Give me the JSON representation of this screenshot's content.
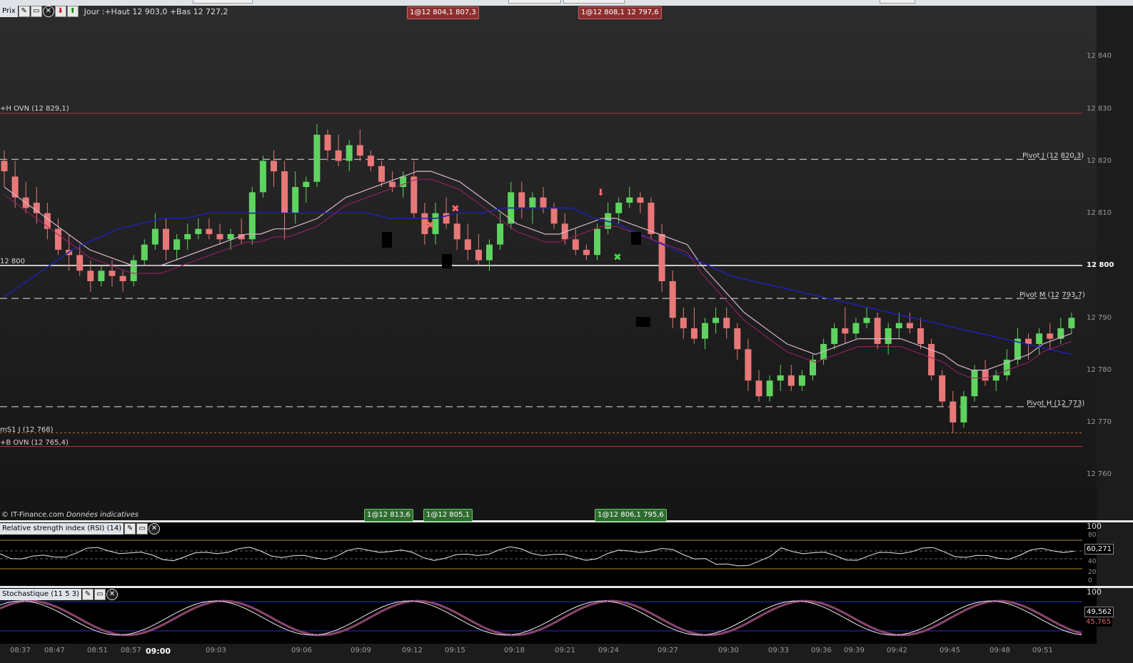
{
  "price_panel": {
    "toolbar_label": "Prix",
    "info": "Jour :+Haut 12 903,0 +Bas 12 727,2",
    "copyright": "© IT-Finance.com",
    "disclaimer": "Données indicatives",
    "levels": [
      {
        "label": "+H OVN (12 829,1)",
        "value": 12829.1,
        "style": "solid",
        "color": "#b43a3a"
      },
      {
        "label": "Pivot J (12 820,3)",
        "value": 12820.3,
        "style": "dashed",
        "color": "#e0e0e0"
      },
      {
        "label": "12 800",
        "value": 12800,
        "style": "solid",
        "color": "#ffffff"
      },
      {
        "label": "Pivot M (12 793,7)",
        "value": 12793.7,
        "style": "dashed",
        "color": "#e0e0e0"
      },
      {
        "label": "Pivot H (12 773)",
        "value": 12773,
        "style": "dashed",
        "color": "#e0e0e0"
      },
      {
        "label": "mS1 J (12 768)",
        "value": 12768,
        "style": "dotted",
        "color": "#b86a2a"
      },
      {
        "label": "+B OVN (12 765,4)",
        "value": 12765.4,
        "style": "solid",
        "color": "#b43a3a"
      }
    ],
    "sell_orders": [
      "1@12 804,1",
      "807,3",
      "1@12 808,1",
      "12 797,6"
    ],
    "buy_orders": [
      "1@12 813,6",
      "1@12 805,1",
      "1@12 806,1",
      "795,6"
    ],
    "y_ticks": [
      "12 840",
      "12 830",
      "12 820",
      "12 810",
      "12 800",
      "12 790",
      "12 780",
      "12 770",
      "12 760"
    ]
  },
  "rsi_panel": {
    "label": "Relative strength index (RSI) (14)",
    "value": "60,271",
    "ticks": [
      "100",
      "80",
      "60",
      "40",
      "20",
      "0"
    ]
  },
  "stoch_panel": {
    "label": "Stochastique (11 5 3)",
    "value1": "49,562",
    "value2": "45,765",
    "tick": "100"
  },
  "time_axis": [
    "08:37",
    "08:47",
    "08:51",
    "08:57",
    "09:00",
    "09:03",
    "09:06",
    "09:09",
    "09:12",
    "09:15",
    "09:18",
    "09:21",
    "09:24",
    "09:27",
    "09:30",
    "09:33",
    "09:36",
    "09:39",
    "09:42",
    "09:45",
    "09:48",
    "09:51"
  ],
  "colors": {
    "up": "#5fd35f",
    "down": "#e87878",
    "sma_fast": "#d8b6d0",
    "sma_slow": "#2020b0",
    "envelope": "#a0206a"
  },
  "chart_data": {
    "type": "candlestick",
    "ohlc": [
      [
        12820,
        12822,
        12815,
        12818
      ],
      [
        12817,
        12820,
        12811,
        12813
      ],
      [
        12813,
        12816,
        12810,
        12811
      ],
      [
        12812,
        12815,
        12808,
        12810
      ],
      [
        12810,
        12812,
        12805,
        12807
      ],
      [
        12807,
        12809,
        12802,
        12803
      ],
      [
        12803,
        12806,
        12799,
        12802
      ],
      [
        12802,
        12804,
        12798,
        12799
      ],
      [
        12799,
        12801,
        12795,
        12797
      ],
      [
        12797,
        12800,
        12796,
        12799
      ],
      [
        12799,
        12801,
        12796,
        12798
      ],
      [
        12798,
        12799,
        12795,
        12797
      ],
      [
        12797,
        12802,
        12796,
        12801
      ],
      [
        12801,
        12805,
        12800,
        12804
      ],
      [
        12804,
        12810,
        12803,
        12807
      ],
      [
        12807,
        12809,
        12801,
        12803
      ],
      [
        12803,
        12806,
        12801,
        12805
      ],
      [
        12805,
        12808,
        12803,
        12806
      ],
      [
        12806,
        12809,
        12805,
        12807
      ],
      [
        12807,
        12809,
        12805,
        12806
      ],
      [
        12806,
        12808,
        12804,
        12805
      ],
      [
        12805,
        12807,
        12803,
        12806
      ],
      [
        12806,
        12809,
        12804,
        12805
      ],
      [
        12805,
        12815,
        12804,
        12814
      ],
      [
        12814,
        12821,
        12813,
        12820
      ],
      [
        12820,
        12822,
        12815,
        12818
      ],
      [
        12818,
        12820,
        12805,
        12810
      ],
      [
        12810,
        12818,
        12808,
        12815
      ],
      [
        12815,
        12817,
        12812,
        12816
      ],
      [
        12816,
        12827,
        12815,
        12825
      ],
      [
        12825,
        12826,
        12820,
        12822
      ],
      [
        12822,
        12825,
        12819,
        12820
      ],
      [
        12820,
        12824,
        12818,
        12823
      ],
      [
        12823,
        12826,
        12820,
        12821
      ],
      [
        12821,
        12822,
        12818,
        12819
      ],
      [
        12819,
        12820,
        12815,
        12816
      ],
      [
        12816,
        12818,
        12814,
        12815
      ],
      [
        12815,
        12818,
        12813,
        12817
      ],
      [
        12817,
        12820,
        12809,
        12810
      ],
      [
        12810,
        12812,
        12804,
        12806
      ],
      [
        12806,
        12812,
        12804,
        12810
      ],
      [
        12810,
        12813,
        12807,
        12808
      ],
      [
        12808,
        12810,
        12803,
        12805
      ],
      [
        12805,
        12808,
        12801,
        12803
      ],
      [
        12803,
        12806,
        12800,
        12801
      ],
      [
        12801,
        12805,
        12799,
        12804
      ],
      [
        12804,
        12810,
        12803,
        12808
      ],
      [
        12808,
        12816,
        12807,
        12814
      ],
      [
        12814,
        12816,
        12809,
        12811
      ],
      [
        12811,
        12814,
        12808,
        12813
      ],
      [
        12813,
        12815,
        12810,
        12811
      ],
      [
        12811,
        12812,
        12807,
        12808
      ],
      [
        12808,
        12810,
        12804,
        12805
      ],
      [
        12805,
        12807,
        12802,
        12803
      ],
      [
        12803,
        12804,
        12801,
        12802
      ],
      [
        12802,
        12808,
        12801,
        12807
      ],
      [
        12807,
        12812,
        12806,
        12810
      ],
      [
        12810,
        12813,
        12808,
        12812
      ],
      [
        12812,
        12815,
        12811,
        12813
      ],
      [
        12813,
        12814,
        12810,
        12812
      ],
      [
        12812,
        12813,
        12805,
        12806
      ],
      [
        12806,
        12808,
        12795,
        12797
      ],
      [
        12797,
        12799,
        12788,
        12790
      ],
      [
        12790,
        12792,
        12786,
        12788
      ],
      [
        12788,
        12792,
        12785,
        12786
      ],
      [
        12786,
        12790,
        12784,
        12789
      ],
      [
        12789,
        12792,
        12787,
        12790
      ],
      [
        12790,
        12792,
        12786,
        12788
      ],
      [
        12788,
        12789,
        12782,
        12784
      ],
      [
        12784,
        12786,
        12776,
        12778
      ],
      [
        12778,
        12780,
        12774,
        12775
      ],
      [
        12775,
        12779,
        12774,
        12778
      ],
      [
        12778,
        12781,
        12776,
        12779
      ],
      [
        12779,
        12781,
        12776,
        12777
      ],
      [
        12777,
        12780,
        12776,
        12779
      ],
      [
        12779,
        12783,
        12778,
        12782
      ],
      [
        12782,
        12786,
        12781,
        12785
      ],
      [
        12785,
        12789,
        12784,
        12788
      ],
      [
        12788,
        12792,
        12785,
        12787
      ],
      [
        12787,
        12790,
        12786,
        12789
      ],
      [
        12789,
        12792,
        12788,
        12790
      ],
      [
        12790,
        12791,
        12784,
        12785
      ],
      [
        12785,
        12789,
        12783,
        12788
      ],
      [
        12788,
        12791,
        12786,
        12789
      ],
      [
        12789,
        12791,
        12787,
        12788
      ],
      [
        12788,
        12790,
        12784,
        12785
      ],
      [
        12785,
        12786,
        12778,
        12779
      ],
      [
        12779,
        12780,
        12773,
        12774
      ],
      [
        12774,
        12776,
        12768,
        12770
      ],
      [
        12770,
        12776,
        12769,
        12775
      ],
      [
        12775,
        12781,
        12774,
        12780
      ],
      [
        12780,
        12782,
        12777,
        12778
      ],
      [
        12778,
        12780,
        12776,
        12779
      ],
      [
        12779,
        12784,
        12778,
        12782
      ],
      [
        12782,
        12788,
        12781,
        12786
      ],
      [
        12786,
        12787,
        12782,
        12785
      ],
      [
        12785,
        12788,
        12783,
        12787
      ],
      [
        12787,
        12789,
        12784,
        12786
      ],
      [
        12786,
        12790,
        12785,
        12788
      ],
      [
        12788,
        12791,
        12787,
        12790
      ]
    ],
    "sma_fast": [
      12815,
      12813,
      12811,
      12809,
      12807,
      12805,
      12803,
      12802,
      12801,
      12800,
      12800,
      12800,
      12801,
      12802,
      12803,
      12804,
      12805,
      12806,
      12806,
      12807,
      12807,
      12808,
      12809,
      12811,
      12813,
      12814,
      12815,
      12816,
      12817,
      12818,
      12818,
      12817,
      12816,
      12814,
      12812,
      12810,
      12808,
      12807,
      12806,
      12806,
      12807,
      12808,
      12809,
      12809,
      12808,
      12807,
      12806,
      12805,
      12804,
      12800,
      12797,
      12794,
      12791,
      12789,
      12787,
      12785,
      12784,
      12783,
      12784,
      12785,
      12786,
      12786,
      12786,
      12786,
      12785,
      12784,
      12783,
      12781,
      12780,
      12780,
      12781,
      12782,
      12783,
      12785,
      12786,
      12787
    ],
    "sma_slow": [
      12794,
      12797,
      12800,
      12803,
      12805,
      12807,
      12808,
      12809,
      12809,
      12810,
      12810,
      12810,
      12810,
      12810,
      12810,
      12810,
      12810,
      12809,
      12809,
      12809,
      12810,
      12810,
      12811,
      12811,
      12811,
      12811,
      12809,
      12808,
      12806,
      12804,
      12802,
      12800,
      12798,
      12797,
      12796,
      12795,
      12794,
      12793,
      12792,
      12791,
      12790,
      12789,
      12788,
      12787,
      12786,
      12785,
      12784,
      12783
    ]
  }
}
